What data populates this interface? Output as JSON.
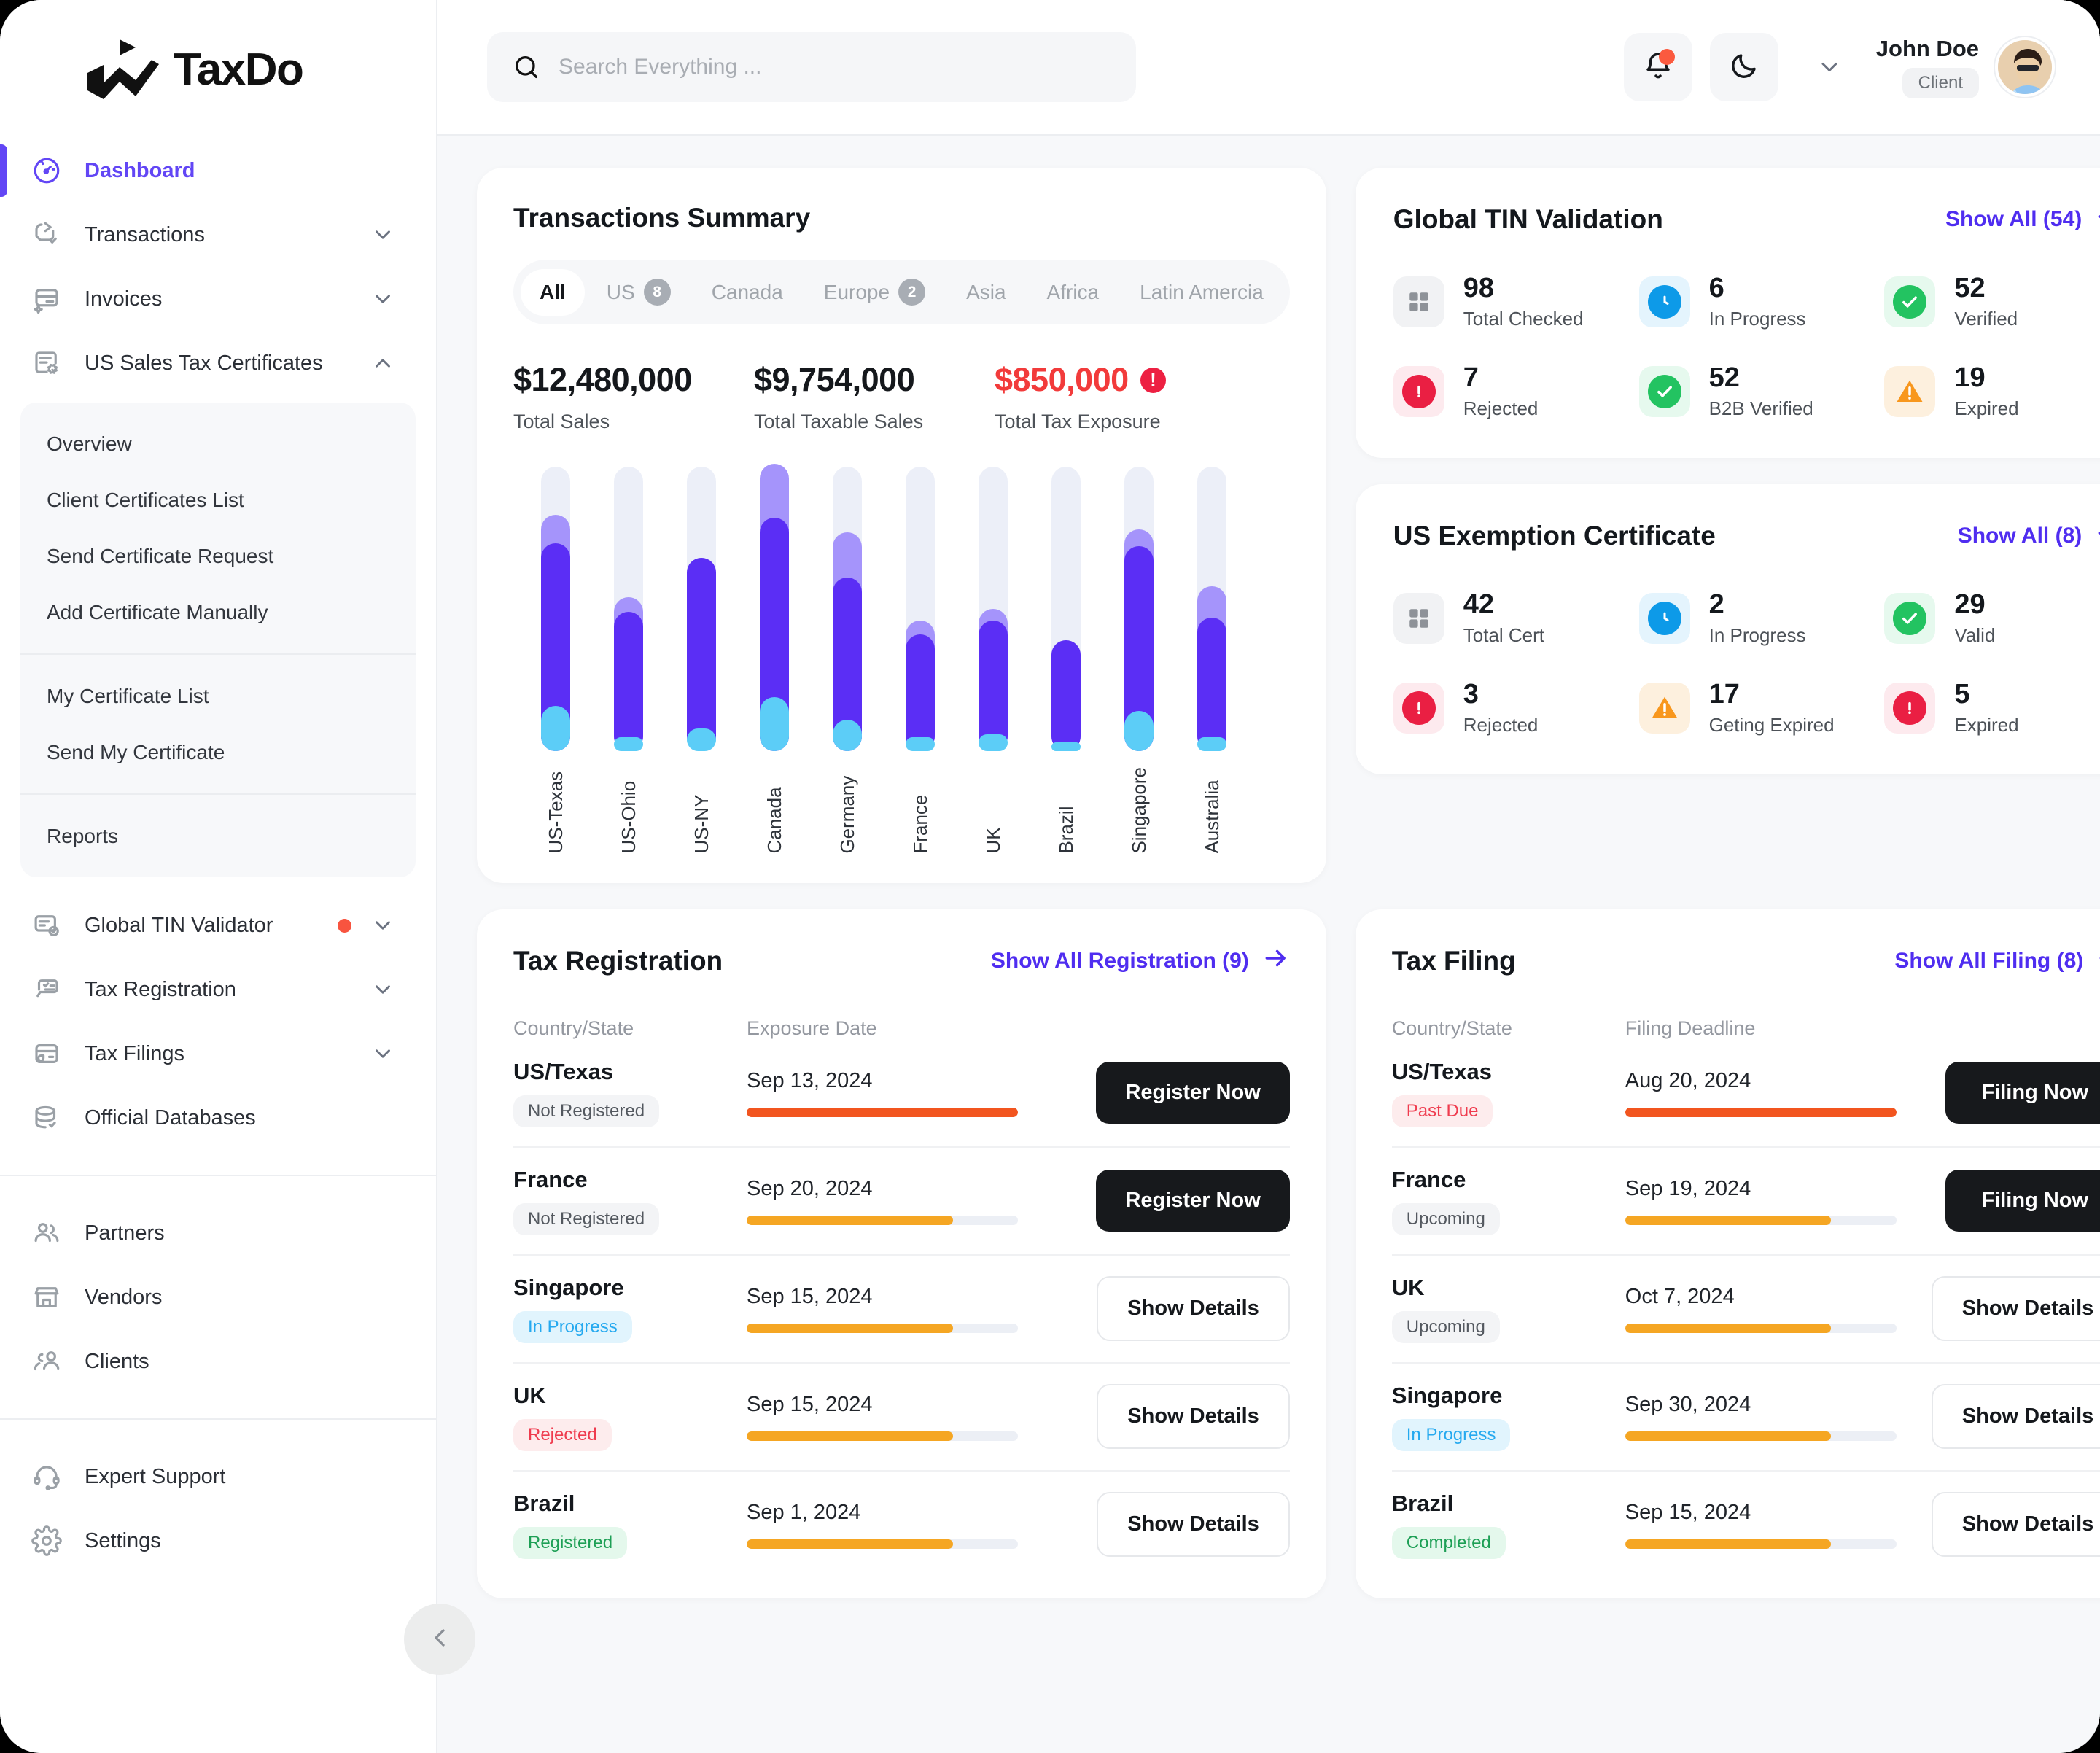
{
  "brand": {
    "name": "TaxDo"
  },
  "search": {
    "value": "",
    "placeholder": "Search Everything ..."
  },
  "user": {
    "name": "John Doe",
    "role": "Client"
  },
  "sidebar": {
    "items": [
      {
        "label": "Dashboard",
        "icon": "gauge-icon",
        "active": true,
        "chevron": ""
      },
      {
        "label": "Transactions",
        "icon": "transactions-icon",
        "chevron": "down"
      },
      {
        "label": "Invoices",
        "icon": "invoice-icon",
        "chevron": "down"
      },
      {
        "label": "US Sales Tax Certificates",
        "icon": "certificate-icon",
        "chevron": "up"
      }
    ],
    "submenu_groups": [
      {
        "items": [
          "Overview",
          "Client Certificates List",
          "Send Certificate Request",
          "Add Certificate Manually"
        ]
      },
      {
        "items": [
          "My Certificate List",
          "Send My Certificate"
        ]
      },
      {
        "items": [
          "Reports"
        ]
      }
    ],
    "items2": [
      {
        "label": "Global TIN Validator",
        "icon": "tin-validator-icon",
        "chevron": "down",
        "dot": true
      },
      {
        "label": "Tax Registration",
        "icon": "tax-registration-icon",
        "chevron": "down"
      },
      {
        "label": "Tax Filings",
        "icon": "tax-filings-icon",
        "chevron": "down"
      },
      {
        "label": "Official Databases",
        "icon": "database-icon",
        "chevron": ""
      }
    ],
    "items3": [
      {
        "label": "Partners",
        "icon": "partners-icon"
      },
      {
        "label": "Vendors",
        "icon": "vendors-icon"
      },
      {
        "label": "Clients",
        "icon": "clients-icon"
      }
    ],
    "items4": [
      {
        "label": "Expert Support",
        "icon": "headset-icon"
      },
      {
        "label": "Settings",
        "icon": "gear-icon"
      }
    ]
  },
  "transactions": {
    "title": "Transactions Summary",
    "tabs": [
      {
        "label": "All",
        "count": "",
        "active": true
      },
      {
        "label": "US",
        "count": "8"
      },
      {
        "label": "Canada",
        "count": ""
      },
      {
        "label": "Europe",
        "count": "2"
      },
      {
        "label": "Asia",
        "count": ""
      },
      {
        "label": "Africa",
        "count": ""
      },
      {
        "label": "Latin Amercia",
        "count": ""
      }
    ],
    "stats": [
      {
        "value": "$12,480,000",
        "label": "Total Sales",
        "danger": false
      },
      {
        "value": "$9,754,000",
        "label": "Total Taxable Sales",
        "danger": false
      },
      {
        "value": "$850,000",
        "label": "Total Tax Exposure",
        "danger": true
      }
    ]
  },
  "chart_data": {
    "type": "bar",
    "title": "Transactions Summary",
    "xlabel": "",
    "ylabel": "",
    "grid": false,
    "legend": false,
    "stacked": true,
    "ylim": [
      0,
      100
    ],
    "categories": [
      "US-Texas",
      "US-Ohio",
      "US-NY",
      "Canada",
      "Germany",
      "France",
      "UK",
      "Brazil",
      "Singapore",
      "Australia"
    ],
    "series": [
      {
        "name": "Taxable Sales",
        "color": "#5ccdf7",
        "values": [
          16,
          5,
          8,
          19,
          11,
          5,
          6,
          3,
          14,
          5
        ]
      },
      {
        "name": "Total Sales",
        "color": "#5b2ef5",
        "values": [
          57,
          44,
          60,
          63,
          50,
          36,
          40,
          36,
          58,
          42
        ]
      },
      {
        "name": "Tax Exposure",
        "color": "#a594fb",
        "values": [
          10,
          5,
          0,
          19,
          16,
          5,
          4,
          0,
          6,
          11
        ]
      }
    ]
  },
  "tin": {
    "title": "Global TIN Validation",
    "show_all": "Show All (54)",
    "items": [
      {
        "num": "98",
        "label": "Total Checked",
        "icon": "grid-icon",
        "tone": "grey"
      },
      {
        "num": "6",
        "label": "In Progress",
        "icon": "clock-icon",
        "tone": "blue"
      },
      {
        "num": "52",
        "label": "Verified",
        "icon": "check-circle-icon",
        "tone": "green"
      },
      {
        "num": "7",
        "label": "Rejected",
        "icon": "error-circle-icon",
        "tone": "red"
      },
      {
        "num": "52",
        "label": "B2B Verified",
        "icon": "check-circle-icon",
        "tone": "green"
      },
      {
        "num": "19",
        "label": "Expired",
        "icon": "warning-triangle-icon",
        "tone": "amber"
      }
    ]
  },
  "exemption": {
    "title": "US Exemption Certificate",
    "show_all": "Show All (8)",
    "items": [
      {
        "num": "42",
        "label": "Total Cert",
        "icon": "grid-icon",
        "tone": "grey"
      },
      {
        "num": "2",
        "label": "In Progress",
        "icon": "clock-icon",
        "tone": "blue"
      },
      {
        "num": "29",
        "label": "Valid",
        "icon": "check-circle-icon",
        "tone": "green"
      },
      {
        "num": "3",
        "label": "Rejected",
        "icon": "error-circle-icon",
        "tone": "red"
      },
      {
        "num": "17",
        "label": "Geting Expired",
        "icon": "warning-triangle-icon",
        "tone": "amber"
      },
      {
        "num": "5",
        "label": "Expired",
        "icon": "error-circle-icon",
        "tone": "red"
      }
    ]
  },
  "registration": {
    "title": "Tax Registration",
    "show_all": "Show All Registration (9)",
    "col_country": "Country/State",
    "col_date": "Exposure Date",
    "rows": [
      {
        "country": "US/Texas",
        "status": "Not Registered",
        "tone": "grey",
        "date": "Sep 13, 2024",
        "pct": 100,
        "bar": "#f2551f",
        "action": "Register Now",
        "style": "dark"
      },
      {
        "country": "France",
        "status": "Not Registered",
        "tone": "grey",
        "date": "Sep 20, 2024",
        "pct": 76,
        "bar": "#f5a623",
        "action": "Register Now",
        "style": "dark"
      },
      {
        "country": "Singapore",
        "status": "In Progress",
        "tone": "blue",
        "date": "Sep 15, 2024",
        "pct": 76,
        "bar": "#f5a623",
        "action": "Show Details",
        "style": "ghost"
      },
      {
        "country": "UK",
        "status": "Rejected",
        "tone": "red",
        "date": "Sep 15, 2024",
        "pct": 76,
        "bar": "#f5a623",
        "action": "Show Details",
        "style": "ghost"
      },
      {
        "country": "Brazil",
        "status": "Registered",
        "tone": "green",
        "date": "Sep 1, 2024",
        "pct": 76,
        "bar": "#f5a623",
        "action": "Show Details",
        "style": "ghost"
      }
    ]
  },
  "filing": {
    "title": "Tax Filing",
    "show_all": "Show All Filing (8)",
    "col_country": "Country/State",
    "col_date": "Filing Deadline",
    "rows": [
      {
        "country": "US/Texas",
        "status": "Past Due",
        "tone": "red",
        "date": "Aug 20, 2024",
        "pct": 100,
        "bar": "#f2551f",
        "action": "Filing Now",
        "style": "dark"
      },
      {
        "country": "France",
        "status": "Upcoming",
        "tone": "grey",
        "date": "Sep 19, 2024",
        "pct": 76,
        "bar": "#f5a623",
        "action": "Filing Now",
        "style": "dark"
      },
      {
        "country": "UK",
        "status": "Upcoming",
        "tone": "grey",
        "date": "Oct 7, 2024",
        "pct": 76,
        "bar": "#f5a623",
        "action": "Show Details",
        "style": "ghost"
      },
      {
        "country": "Singapore",
        "status": "In Progress",
        "tone": "blue",
        "date": "Sep 30, 2024",
        "pct": 76,
        "bar": "#f5a623",
        "action": "Show Details",
        "style": "ghost"
      },
      {
        "country": "Brazil",
        "status": "Completed",
        "tone": "green",
        "date": "Sep 15, 2024",
        "pct": 76,
        "bar": "#f5a623",
        "action": "Show Details",
        "style": "ghost"
      }
    ]
  },
  "colors": {
    "accent": "#6246f5",
    "link": "#4f2df0",
    "danger": "#f23b3b",
    "warn": "#f5a623",
    "orange": "#f2551f",
    "green": "#23c361",
    "blue": "#0d9ae8"
  }
}
